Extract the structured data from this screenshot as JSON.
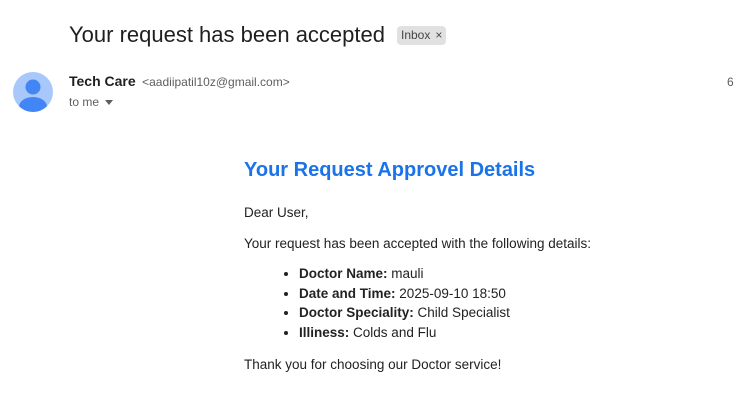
{
  "header": {
    "subject": "Your request has been accepted",
    "badge_label": "Inbox",
    "badge_close": "×"
  },
  "sender": {
    "name": "Tech Care",
    "email": "<aadiipatil10z@gmail.com>",
    "to_label": "to me",
    "time_partial": "6"
  },
  "colors": {
    "heading": "#1a73e8",
    "avatar_bg": "#a8c7fa",
    "avatar_fg": "#4285f4"
  },
  "message": {
    "heading": "Your Request Approvel Details",
    "greeting": "Dear User,",
    "intro": "Your request has been accepted with the following details:",
    "details": [
      {
        "label": "Doctor Name:",
        "value": "mauli"
      },
      {
        "label": "Date and Time:",
        "value": "2025-09-10 18:50"
      },
      {
        "label": "Doctor Speciality:",
        "value": "Child Specialist"
      },
      {
        "label": "Illiness:",
        "value": "Colds and Flu"
      }
    ],
    "closing": "Thank you for choosing our Doctor service!"
  }
}
